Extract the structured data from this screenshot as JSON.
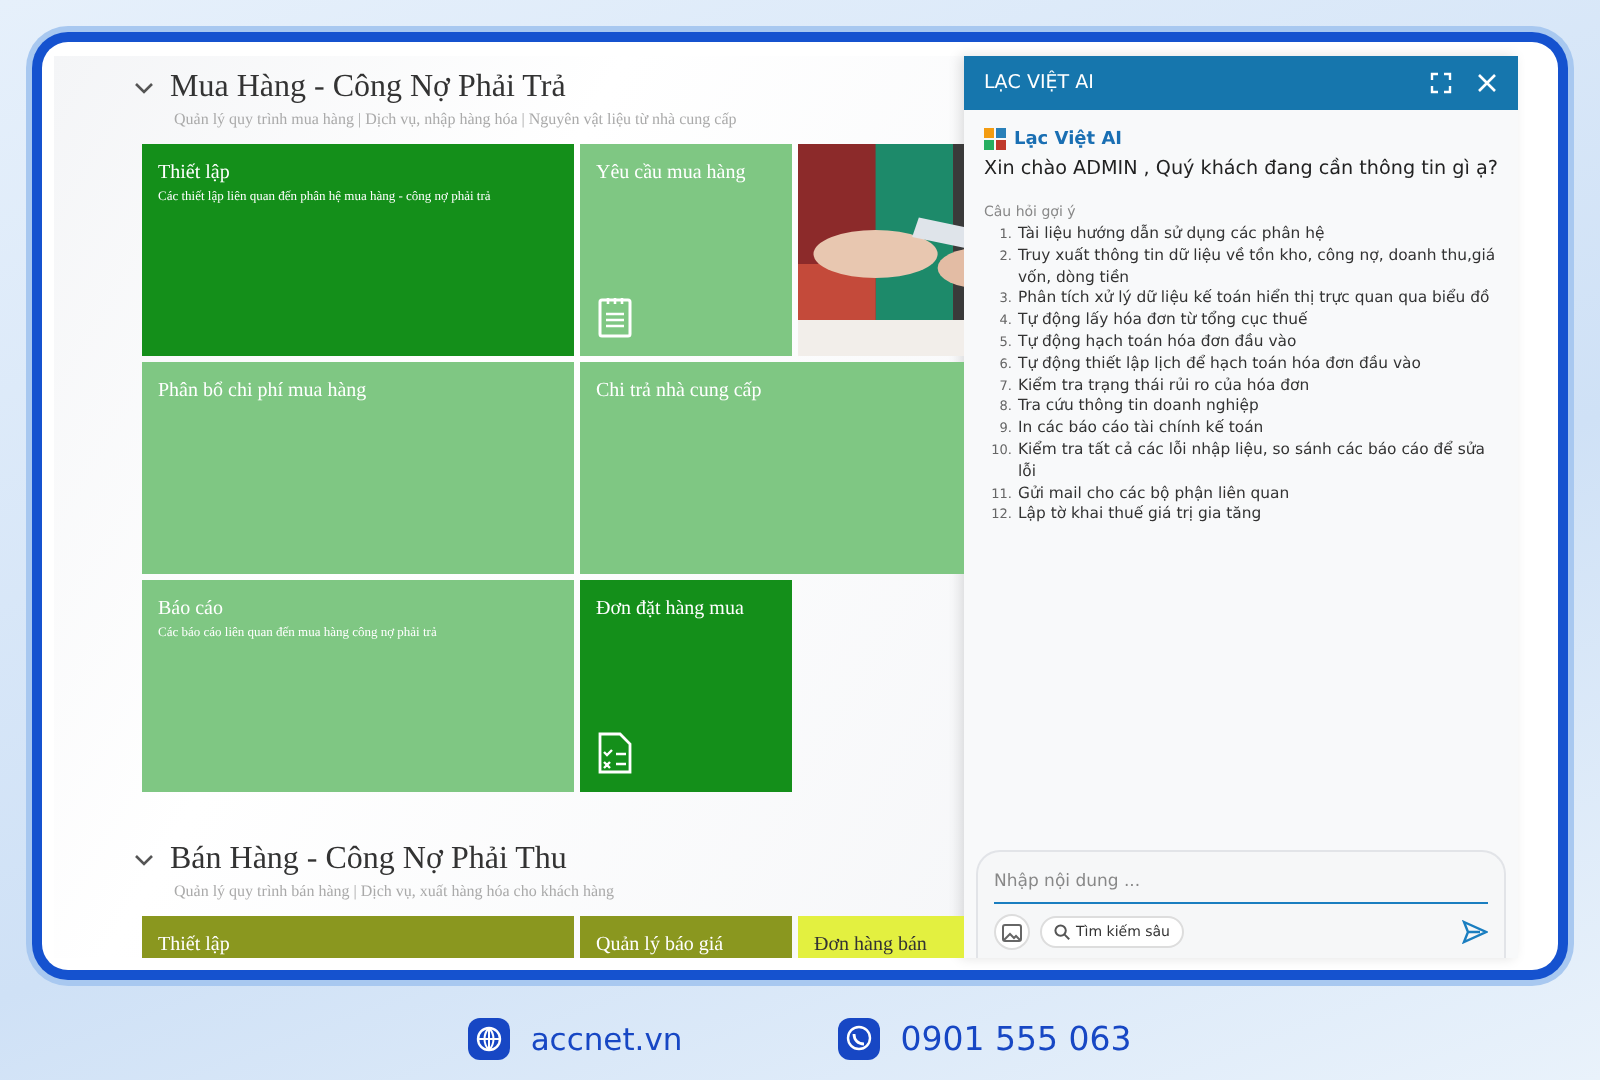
{
  "sections": [
    {
      "title": "Mua Hàng - Công Nợ Phải Trả",
      "subtitle": "Quản lý quy trình mua hàng | Dịch vụ, nhập hàng hóa | Nguyên vật liệu từ nhà cung cấp",
      "expanded": true,
      "tiles": [
        {
          "kind": "text",
          "title": "Thiết lập",
          "description": "Các thiết lập liên quan đến phân hệ mua hàng - công nợ phải trả",
          "color": "#148f1a"
        },
        {
          "kind": "clipboard",
          "title": "Yêu cầu mua hàng",
          "color": "#7fc783"
        },
        {
          "kind": "picture"
        },
        {
          "kind": "text",
          "title": "Phân bổ chi phí mua hàng",
          "color": "#7fc783"
        },
        {
          "kind": "wide",
          "title": "Chi trả nhà cung cấp",
          "color": "#7fc783"
        },
        {
          "kind": "text",
          "title": "Báo cáo",
          "description": "Các báo cáo liên quan đến mua hàng công nợ phải trả",
          "color": "#7fc783"
        },
        {
          "kind": "checklist",
          "title": "Đơn đặt hàng mua",
          "color": "#148f1a"
        }
      ]
    },
    {
      "title": "Bán Hàng - Công Nợ Phải Thu",
      "subtitle": "Quản lý quy trình bán hàng | Dịch vụ, xuất hàng hóa cho khách hàng",
      "expanded": true,
      "tiles": [
        {
          "kind": "text",
          "title": "Thiết lập",
          "color": "#8a971f"
        },
        {
          "kind": "text",
          "title": "Quản lý báo giá",
          "color": "#8a971f"
        },
        {
          "kind": "text",
          "title": "Đơn hàng bán",
          "color": "#e3f040"
        }
      ]
    }
  ],
  "chat": {
    "title": "LẠC VIỆT AI",
    "brand": "Lạc Việt AI",
    "greeting": "Xin chào ADMIN , Quý khách đang cần thông tin gì ạ?",
    "suggestions_label": "Câu hỏi gợi ý",
    "suggestions": [
      {
        "number": "1.",
        "text": "Tài liệu hướng dẫn sử dụng các phân hệ"
      },
      {
        "number": "2.",
        "text": "Truy xuất thông tin dữ liệu về tồn kho, công nợ, doanh thu,giá vốn, dòng tiền"
      },
      {
        "number": "3.",
        "text": "Phân tích xử lý dữ liệu kế toán hiển thị trực quan qua biểu đồ"
      },
      {
        "number": "4.",
        "text": "Tự động lấy hóa đơn từ tổng cục thuế"
      },
      {
        "number": "5.",
        "text": "Tự động hạch toán hóa đơn đầu vào"
      },
      {
        "number": "6.",
        "text": "Tự động thiết lập lịch để hạch toán hóa đơn đầu vào"
      },
      {
        "number": "7.",
        "text": "Kiểm tra trạng thái rủi ro của hóa đơn"
      },
      {
        "number": "8.",
        "text": "Tra cứu thông tin doanh nghiệp"
      },
      {
        "number": "9.",
        "text": "In các báo cáo tài chính kế toán"
      },
      {
        "number": "10.",
        "text": "Kiểm tra tất cả các lỗi nhập liệu, so sánh các báo cáo để sửa lỗi"
      },
      {
        "number": "11.",
        "text": "Gửi mail cho các bộ phận liên quan"
      },
      {
        "number": "12.",
        "text": "Lập tờ khai thuế giá trị gia tăng"
      }
    ],
    "input": {
      "placeholder": "Nhập nội dung ..."
    },
    "deep_search": "Tìm kiếm sâu"
  },
  "footer": {
    "website": "accnet.vn",
    "phone": "0901 555 063"
  }
}
